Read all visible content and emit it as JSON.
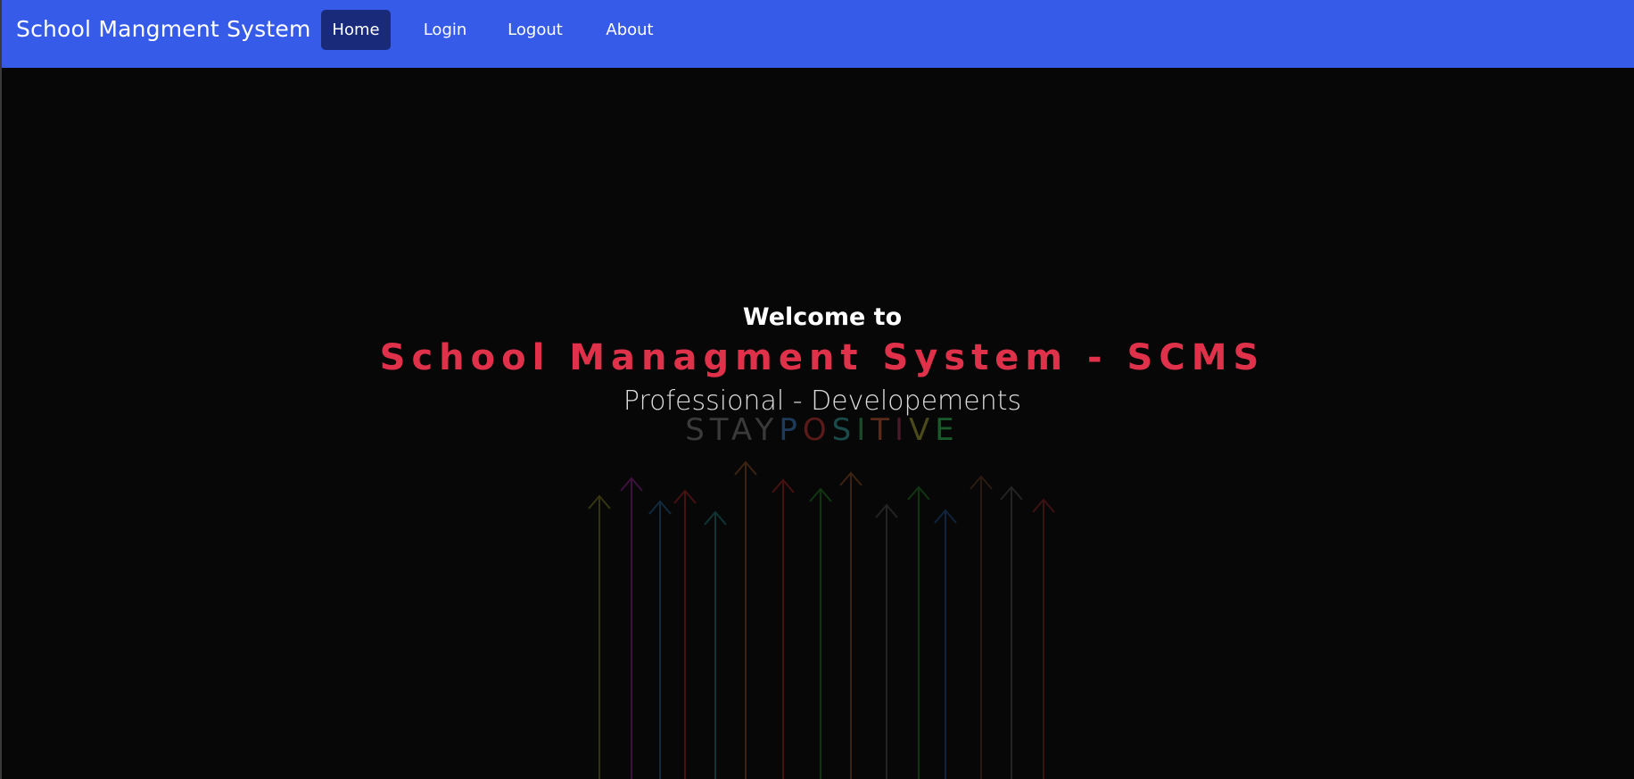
{
  "navbar": {
    "brand": "School Mangment System",
    "links": [
      {
        "label": "Home",
        "active": true
      },
      {
        "label": "Login",
        "active": false
      },
      {
        "label": "Logout",
        "active": false
      },
      {
        "label": "About",
        "active": false
      }
    ]
  },
  "hero": {
    "welcome": "Welcome to",
    "title": "School Managment System - SCMS",
    "subtitle": "Professional - Developements",
    "background_art": {
      "word1": "STAY",
      "word2_letters": [
        "P",
        "O",
        "S",
        "I",
        "T",
        "I",
        "V",
        "E"
      ]
    }
  },
  "colors": {
    "navbar_bg": "#365be8",
    "active_link_bg": "#1a2a7a",
    "title_color": "#e0314b",
    "page_bg": "#070707"
  }
}
